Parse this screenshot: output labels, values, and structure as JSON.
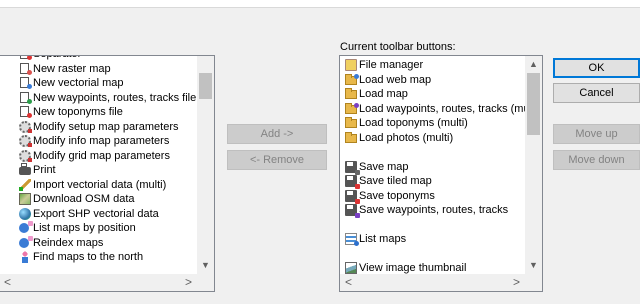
{
  "current_label": "Current toolbar buttons:",
  "available": {
    "items": [
      {
        "label": "Separator",
        "icon": "separator-icon"
      },
      {
        "label": "New raster map",
        "icon": "new-raster-map-icon"
      },
      {
        "label": "New vectorial map",
        "icon": "new-vectorial-map-icon"
      },
      {
        "label": "New waypoints, routes, tracks file",
        "icon": "new-waypoints-file-icon"
      },
      {
        "label": "New toponyms file",
        "icon": "new-toponyms-file-icon"
      },
      {
        "label": "Modify setup map parameters",
        "icon": "setup-map-parameters-icon"
      },
      {
        "label": "Modify info map parameters",
        "icon": "info-map-parameters-icon"
      },
      {
        "label": "Modify grid map parameters",
        "icon": "grid-map-parameters-icon"
      },
      {
        "label": "Print",
        "icon": "printer-icon"
      },
      {
        "label": "Import vectorial data  (multi)",
        "icon": "import-vectorial-icon"
      },
      {
        "label": "Download OSM data",
        "icon": "download-osm-icon"
      },
      {
        "label": "Export SHP vectorial data",
        "icon": "export-shp-icon"
      },
      {
        "label": "List maps by position",
        "icon": "list-maps-position-icon"
      },
      {
        "label": "Reindex maps",
        "icon": "reindex-maps-icon"
      },
      {
        "label": "Find maps to the north",
        "icon": "find-maps-north-icon"
      }
    ]
  },
  "current": {
    "items": [
      {
        "label": "File manager",
        "icon": "file-manager-icon"
      },
      {
        "label": "Load web map",
        "icon": "load-web-map-icon"
      },
      {
        "label": "Load map",
        "icon": "load-map-icon"
      },
      {
        "label": "Load waypoints, routes, tracks (multi)",
        "icon": "load-waypoints-icon"
      },
      {
        "label": "Load toponyms (multi)",
        "icon": "load-toponyms-icon"
      },
      {
        "label": "Load photos (multi)",
        "icon": "load-photos-icon"
      },
      {
        "label": "",
        "icon": ""
      },
      {
        "label": "Save map",
        "icon": "save-map-icon"
      },
      {
        "label": "Save tiled map",
        "icon": "save-tiled-map-icon"
      },
      {
        "label": "Save toponyms",
        "icon": "save-toponyms-icon"
      },
      {
        "label": "Save waypoints, routes, tracks",
        "icon": "save-waypoints-icon"
      },
      {
        "label": "",
        "icon": ""
      },
      {
        "label": "List maps",
        "icon": "list-maps-icon"
      },
      {
        "label": "",
        "icon": ""
      },
      {
        "label": "View image thumbnail",
        "icon": "image-thumbnail-icon"
      }
    ]
  },
  "buttons": {
    "add": "Add ->",
    "remove": "<- Remove",
    "ok": "OK",
    "cancel": "Cancel",
    "move_up": "Move up",
    "move_down": "Move down"
  },
  "scroll": {
    "up": "▲",
    "down": "▼",
    "left": "<",
    "right": ">"
  },
  "colors": {
    "window_bg": "#f0f0f0",
    "list_bg": "#ffffff",
    "default_button_border": "#0078d7",
    "disabled_text": "#838383"
  }
}
